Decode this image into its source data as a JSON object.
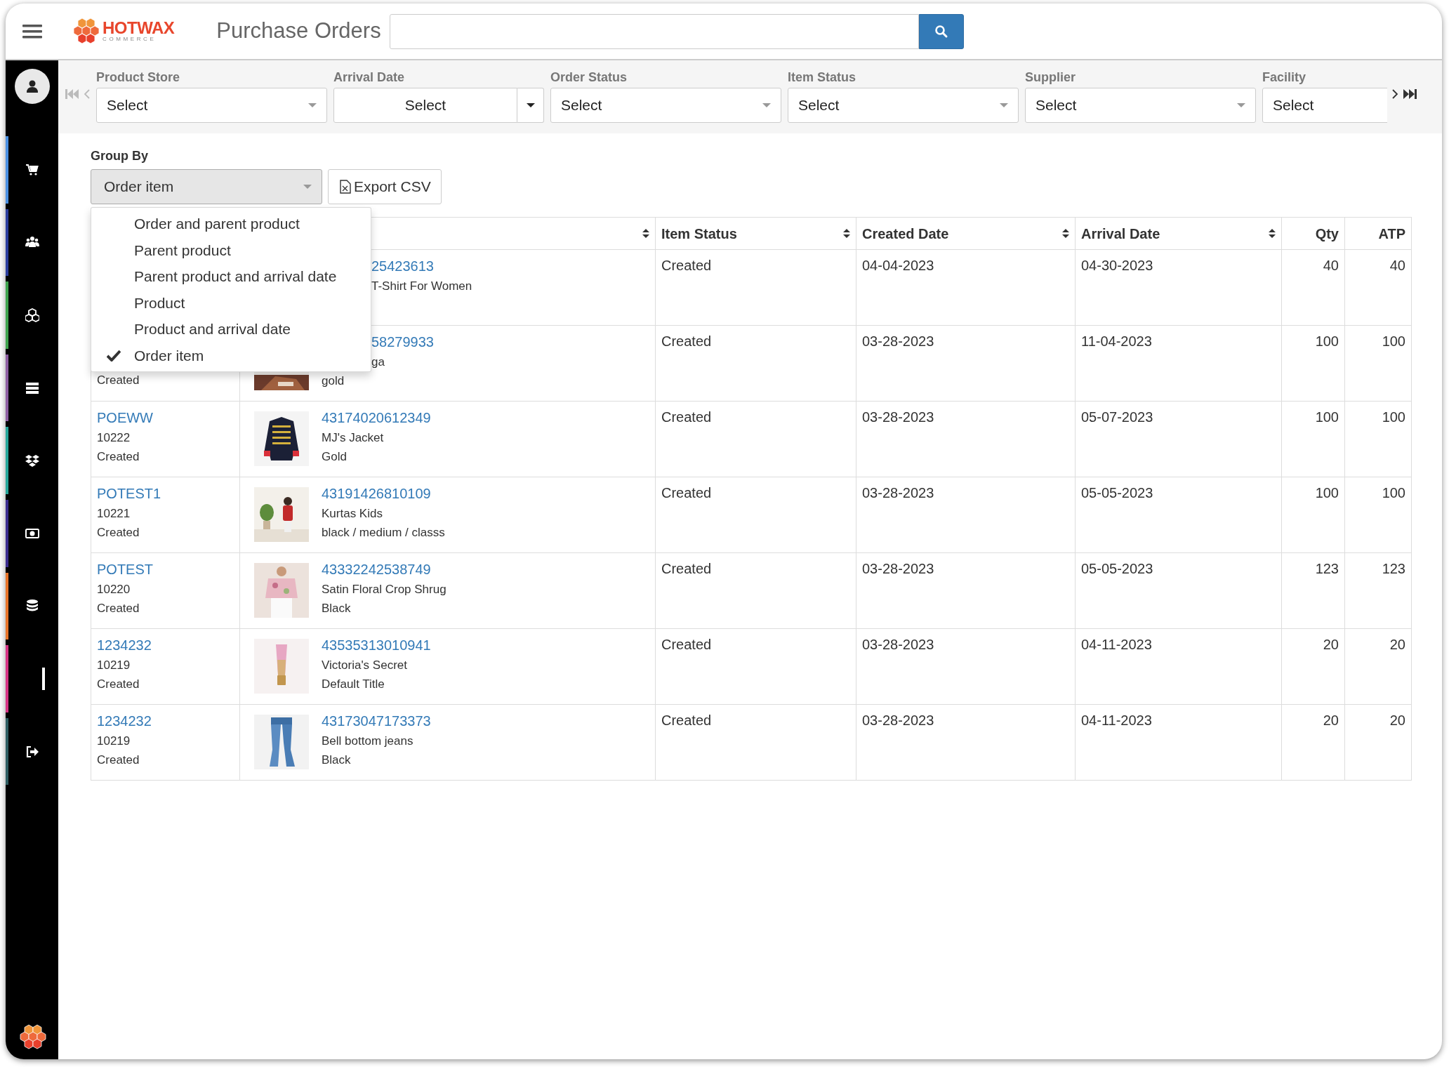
{
  "header": {
    "brand": {
      "name": "HOTWAX",
      "tagline": "COMMERCE"
    },
    "title": "Purchase Orders"
  },
  "sidebar": {
    "items": [
      {
        "color": "#4a90e2"
      },
      {
        "color": "#2c3e9e"
      },
      {
        "color": "#3fa34d"
      },
      {
        "color": "#8e5ea2"
      },
      {
        "color": "#26a69a"
      },
      {
        "color": "#3b2d8f"
      },
      {
        "color": "#e8742a"
      },
      {
        "color": "#d63384"
      },
      {
        "color": "#2f5d62"
      }
    ]
  },
  "pager": {
    "back_disabled": true,
    "forward_disabled": false
  },
  "filters": [
    {
      "label": "Product Store",
      "value": "Select",
      "kind": "select"
    },
    {
      "label": "Arrival Date",
      "value": "Select",
      "kind": "split"
    },
    {
      "label": "Order Status",
      "value": "Select",
      "kind": "select"
    },
    {
      "label": "Item Status",
      "value": "Select",
      "kind": "select"
    },
    {
      "label": "Supplier",
      "value": "Select",
      "kind": "select"
    },
    {
      "label": "Facility",
      "value": "Select",
      "kind": "select"
    }
  ],
  "group_by": {
    "label": "Group By",
    "value": "Order item",
    "open": true,
    "options": [
      {
        "label": "Order and parent product",
        "selected": false
      },
      {
        "label": "Parent product",
        "selected": false
      },
      {
        "label": "Parent product and arrival date",
        "selected": false
      },
      {
        "label": "Product",
        "selected": false
      },
      {
        "label": "Product and arrival date",
        "selected": false
      },
      {
        "label": "Order item",
        "selected": true
      }
    ]
  },
  "export_button": "Export CSV",
  "table": {
    "columns": [
      {},
      {
        "sortable": true
      },
      {
        "label": "Item Status",
        "sortable": true,
        "kind": "text"
      },
      {
        "label": "Created Date",
        "sortable": true,
        "kind": "text"
      },
      {
        "label": "Arrival Date",
        "sortable": true,
        "kind": "text"
      },
      {
        "label": "Qty",
        "sortable": false,
        "kind": "number"
      },
      {
        "label": "ATP",
        "sortable": false,
        "kind": "number"
      }
    ],
    "rows": [
      {
        "order": {},
        "product": {
          "lines": [
            {
              "text": "25423613",
              "kind": "link",
              "cut": true
            },
            {
              "text": "T-Shirt For Women",
              "kind": "text",
              "cut": true
            }
          ]
        },
        "item_status": "Created",
        "created_date": "04-04-2023",
        "arrival_date": "04-30-2023",
        "qty": "40",
        "atp": "40"
      },
      {
        "order": {
          "status": "Created"
        },
        "product": {
          "lines": [
            {
              "text": "58279933",
              "kind": "link",
              "cut": true
            },
            {
              "text": "ga",
              "kind": "text",
              "cut": true
            },
            {
              "text": "gold",
              "kind": "text"
            }
          ]
        },
        "item_status": "Created",
        "created_date": "03-28-2023",
        "arrival_date": "11-04-2023",
        "qty": "100",
        "atp": "100"
      },
      {
        "order": {
          "id": "POEWW",
          "number": "10222",
          "status": "Created"
        },
        "product": {
          "lines": [
            {
              "text": "43174020612349",
              "kind": "link"
            },
            {
              "text": "MJ's Jacket",
              "kind": "text"
            },
            {
              "text": "Gold",
              "kind": "text"
            }
          ]
        },
        "item_status": "Created",
        "created_date": "03-28-2023",
        "arrival_date": "05-07-2023",
        "qty": "100",
        "atp": "100"
      },
      {
        "order": {
          "id": "POTEST1",
          "number": "10221",
          "status": "Created"
        },
        "product": {
          "lines": [
            {
              "text": "43191426810109",
              "kind": "link"
            },
            {
              "text": "Kurtas Kids",
              "kind": "text"
            },
            {
              "text": "black / medium / classs",
              "kind": "text"
            }
          ]
        },
        "item_status": "Created",
        "created_date": "03-28-2023",
        "arrival_date": "05-05-2023",
        "qty": "100",
        "atp": "100"
      },
      {
        "order": {
          "id": "POTEST",
          "number": "10220",
          "status": "Created"
        },
        "product": {
          "lines": [
            {
              "text": "43332242538749",
              "kind": "link"
            },
            {
              "text": "Satin Floral Crop Shrug",
              "kind": "text"
            },
            {
              "text": "Black",
              "kind": "text"
            }
          ]
        },
        "item_status": "Created",
        "created_date": "03-28-2023",
        "arrival_date": "05-05-2023",
        "qty": "123",
        "atp": "123"
      },
      {
        "order": {
          "id": "1234232",
          "number": "10219",
          "status": "Created"
        },
        "product": {
          "lines": [
            {
              "text": "43535313010941",
              "kind": "link"
            },
            {
              "text": "Victoria's Secret",
              "kind": "text"
            },
            {
              "text": "Default Title",
              "kind": "text"
            }
          ]
        },
        "item_status": "Created",
        "created_date": "03-28-2023",
        "arrival_date": "04-11-2023",
        "qty": "20",
        "atp": "20"
      },
      {
        "order": {
          "id": "1234232",
          "number": "10219",
          "status": "Created"
        },
        "product": {
          "lines": [
            {
              "text": "43173047173373",
              "kind": "link"
            },
            {
              "text": "Bell bottom jeans",
              "kind": "text"
            },
            {
              "text": "Black",
              "kind": "text"
            }
          ]
        },
        "item_status": "Created",
        "created_date": "03-28-2023",
        "arrival_date": "04-11-2023",
        "qty": "20",
        "atp": "20"
      }
    ]
  }
}
